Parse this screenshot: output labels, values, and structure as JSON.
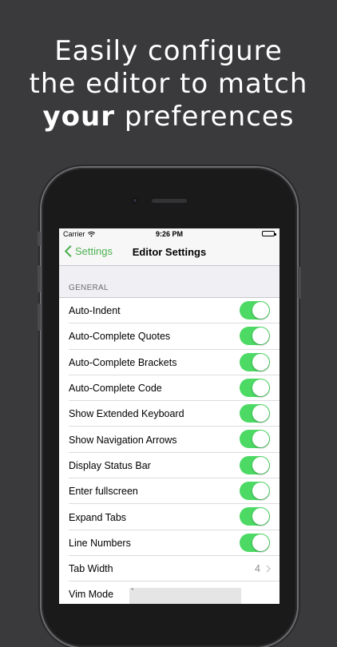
{
  "headline": {
    "line1": "Easily configure",
    "line2": "the editor to match",
    "line3_bold": "your",
    "line3_rest": " preferences"
  },
  "status_bar": {
    "carrier": "Carrier",
    "time": "9:26 PM"
  },
  "nav": {
    "back_label": "Settings",
    "title": "Editor Settings"
  },
  "section": {
    "header": "GENERAL"
  },
  "settings": [
    {
      "label": "Auto-Indent",
      "on": true
    },
    {
      "label": "Auto-Complete Quotes",
      "on": true
    },
    {
      "label": "Auto-Complete Brackets",
      "on": true
    },
    {
      "label": "Auto-Complete Code",
      "on": true
    },
    {
      "label": "Show Extended Keyboard",
      "on": true
    },
    {
      "label": "Show Navigation Arrows",
      "on": true
    },
    {
      "label": "Display Status Bar",
      "on": true
    },
    {
      "label": "Enter fullscreen",
      "on": true
    },
    {
      "label": "Expand Tabs",
      "on": true
    },
    {
      "label": "Line Numbers",
      "on": true
    }
  ],
  "tab_width": {
    "label": "Tab Width",
    "value": "4"
  },
  "vim_mode": {
    "label": "Vim Mode",
    "value": "`"
  },
  "colors": {
    "accent": "#4cb050",
    "toggle_on": "#4cd964",
    "background": "#3a3a3c"
  }
}
